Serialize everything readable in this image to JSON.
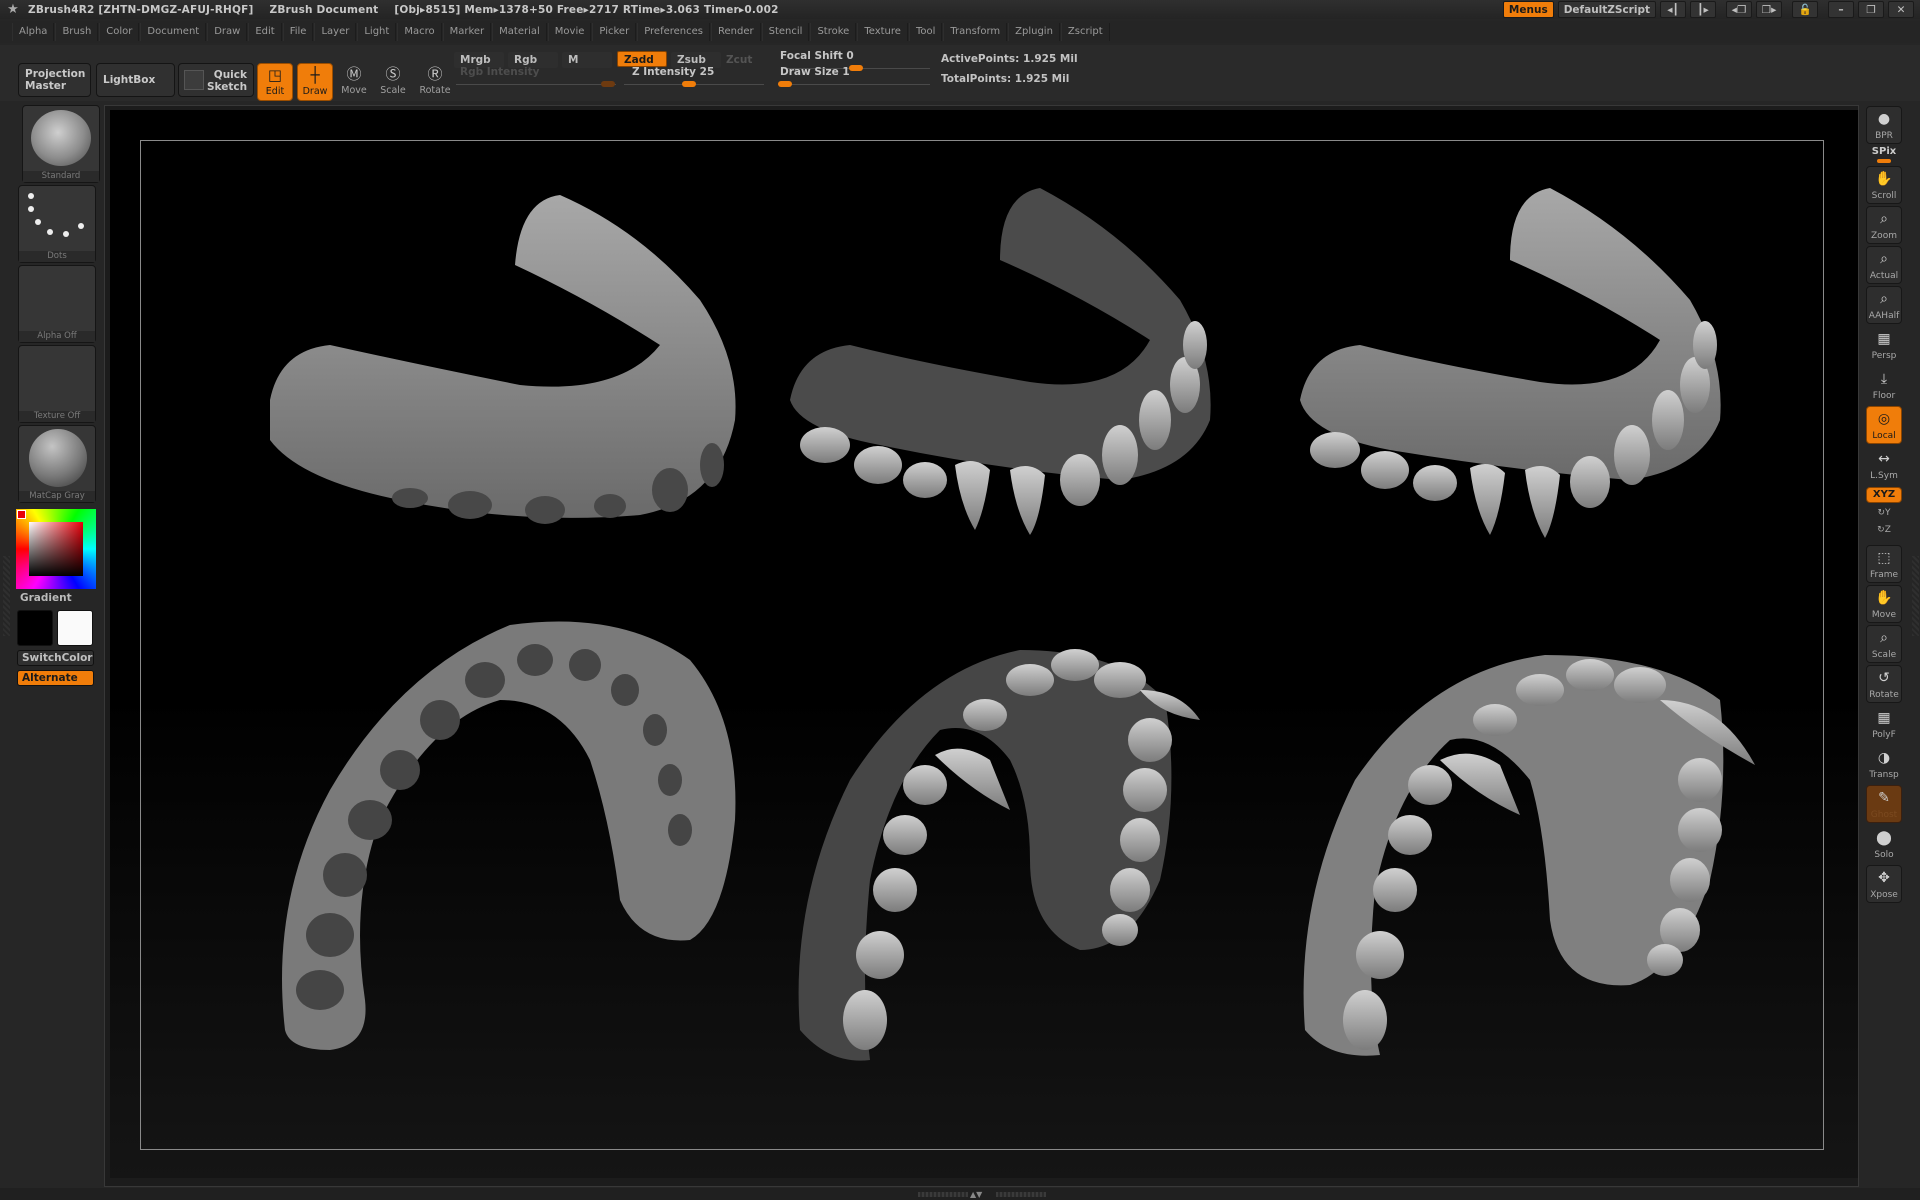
{
  "titlebar": {
    "app": "ZBrush4R2",
    "serial": "[ZHTN-DMGZ-AFUJ-RHQF]",
    "document": "ZBrush Document",
    "obj": "[Obj▸8515]",
    "mem": "Mem▸1378+50",
    "free": "Free▸2717",
    "rtime": "RTime▸3.063",
    "timer": "Timer▸0.002",
    "menus_button": "Menus",
    "script_button": "DefaultZScript"
  },
  "menubar": {
    "items": [
      "Alpha",
      "Brush",
      "Color",
      "Document",
      "Draw",
      "Edit",
      "File",
      "Layer",
      "Light",
      "Macro",
      "Marker",
      "Material",
      "Movie",
      "Picker",
      "Preferences",
      "Render",
      "Stencil",
      "Stroke",
      "Texture",
      "Tool",
      "Transform",
      "Zplugin",
      "Zscript"
    ]
  },
  "shelf": {
    "projection_master": "Projection Master",
    "projection_master_l1": "Projection",
    "projection_master_l2": "Master",
    "lightbox": "LightBox",
    "quick_sketch_l1": "Quick",
    "quick_sketch_l2": "Sketch",
    "edit": "Edit",
    "draw": "Draw",
    "move": "Move",
    "scale": "Scale",
    "rotate": "Rotate",
    "mrgb": "Mrgb",
    "rgb": "Rgb",
    "m": "M",
    "zadd": "Zadd",
    "zsub": "Zsub",
    "zcut": "Zcut",
    "rgb_intensity": "Rgb Intensity",
    "z_intensity": "Z Intensity 25",
    "focal_shift": "Focal Shift 0",
    "draw_size": "Draw Size 1",
    "sliders": {
      "z_intensity": 25,
      "focal_shift": 0,
      "draw_size": 1
    },
    "active_points": "ActivePoints: 1.925 Mil",
    "total_points": "TotalPoints: 1.925 Mil"
  },
  "leftbar": {
    "brush": "Standard",
    "stroke": "Dots",
    "alpha": "Alpha Off",
    "texture": "Texture Off",
    "material": "MatCap Gray",
    "gradient": "Gradient",
    "switch_color": "SwitchColor",
    "alternate": "Alternate",
    "main_color": "#000000",
    "secondary_color": "#ffffff",
    "picker_color": "#e8000a"
  },
  "rightbar": {
    "items": [
      {
        "label": "BPR"
      },
      {
        "label": "SPix"
      },
      {
        "label": "Scroll"
      },
      {
        "label": "Zoom"
      },
      {
        "label": "Actual"
      },
      {
        "label": "AAHalf"
      },
      {
        "label": "Persp"
      },
      {
        "label": "Floor"
      },
      {
        "label": "Local"
      },
      {
        "label": "L.Sym"
      },
      {
        "label": "XYZ"
      },
      {
        "label": "Y"
      },
      {
        "label": "Z"
      },
      {
        "label": "Frame"
      },
      {
        "label": "Move"
      },
      {
        "label": "Scale"
      },
      {
        "label": "Rotate"
      },
      {
        "label": "PolyF"
      },
      {
        "label": "Transp"
      },
      {
        "label": "Ghost"
      },
      {
        "label": "Solo"
      },
      {
        "label": "Xpose"
      }
    ]
  },
  "accent_color": "#f07d0a"
}
